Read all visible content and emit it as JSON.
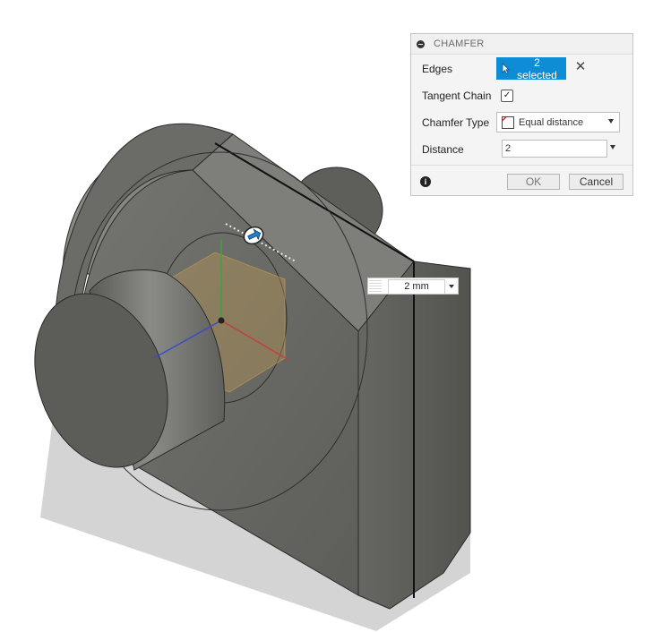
{
  "chamfer_panel": {
    "title": "CHAMFER",
    "edges": {
      "label": "Edges",
      "value": "2 selected"
    },
    "tangent_chain": {
      "label": "Tangent Chain",
      "checked": true
    },
    "chamfer_type": {
      "label": "Chamfer Type",
      "value": "Equal distance"
    },
    "distance": {
      "label": "Distance",
      "value": "2"
    },
    "ok_label": "OK",
    "cancel_label": "Cancel"
  },
  "viewport": {
    "distance_manipulator": {
      "value": "2 mm"
    }
  },
  "colors": {
    "accent": "#0e8dd6",
    "body_face": "#6a6a66",
    "body_side": "#595955",
    "origin_highlight": "#c9a050"
  },
  "icons": [
    "collapse-icon",
    "cursor-icon",
    "close-icon",
    "checkmark-icon",
    "chamfer-type-icon",
    "info-icon",
    "dropdown-arrow-icon",
    "drag-arrow-icon"
  ]
}
